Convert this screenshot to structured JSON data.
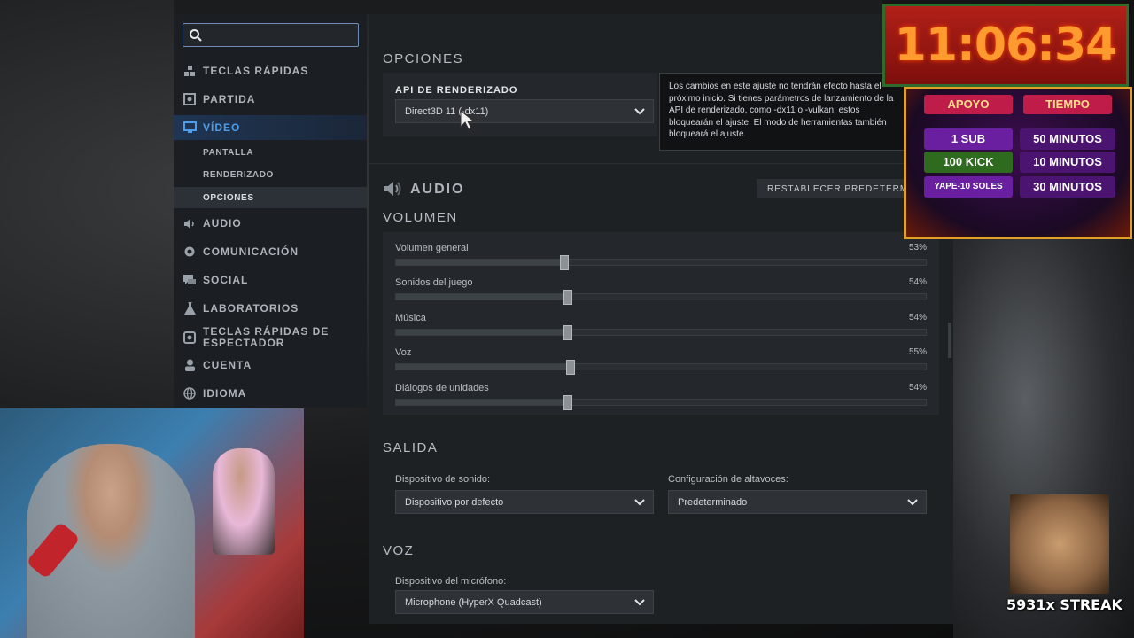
{
  "search": {
    "placeholder": ""
  },
  "sidebar": {
    "items": [
      {
        "label": "TECLAS RÁPIDAS",
        "icon": "hotkeys-icon"
      },
      {
        "label": "PARTIDA",
        "icon": "game-icon"
      },
      {
        "label": "VÍDEO",
        "icon": "monitor-icon",
        "active": true
      },
      {
        "label": "AUDIO",
        "icon": "speaker-icon"
      },
      {
        "label": "COMUNICACIÓN",
        "icon": "gear-icon"
      },
      {
        "label": "SOCIAL",
        "icon": "chat-icon"
      },
      {
        "label": "LABORATORIOS",
        "icon": "flask-icon"
      },
      {
        "label": "TECLAS RÁPIDAS DE ESPECTADOR",
        "icon": "spectator-icon"
      },
      {
        "label": "CUENTA",
        "icon": "user-icon"
      },
      {
        "label": "IDIOMA",
        "icon": "globe-icon"
      }
    ],
    "video_sub": [
      {
        "label": "PANTALLA"
      },
      {
        "label": "RENDERIZADO"
      },
      {
        "label": "OPCIONES",
        "selected": true
      }
    ]
  },
  "options": {
    "title": "OPCIONES",
    "api_label": "API DE RENDERIZADO",
    "api_value": "Direct3D 11 (-dx11)"
  },
  "tooltip": {
    "text": "Los cambios en este ajuste no tendrán efecto hasta el próximo inicio. Si tienes parámetros de lanzamiento de la API de renderizado, como -dx11 o -vulkan, estos bloquearán el ajuste. El modo de herramientas también bloqueará el ajuste."
  },
  "audio": {
    "title": "AUDIO",
    "reset_label": "RESTABLECER PREDETERMINADOS",
    "volume_title": "VOLUMEN",
    "sliders": [
      {
        "label": "Volumen general",
        "value": 53,
        "display": "53%"
      },
      {
        "label": "Sonidos del juego",
        "value": 54,
        "display": "54%"
      },
      {
        "label": "Música",
        "value": 54,
        "display": "54%"
      },
      {
        "label": "Voz",
        "value": 55,
        "display": "55%"
      },
      {
        "label": "Diálogos de unidades",
        "value": 54,
        "display": "54%"
      }
    ],
    "output_title": "SALIDA",
    "sound_device_label": "Dispositivo de sonido:",
    "sound_device_value": "Dispositivo por defecto",
    "speaker_config_label": "Configuración de altavoces:",
    "speaker_config_value": "Predeterminado",
    "voice_title": "VOZ",
    "mic_label": "Dispositivo del micrófono:",
    "mic_value": "Microphone (HyperX Quadcast)"
  },
  "overlay": {
    "clock": "11:06:34",
    "support_header": "APOYO",
    "time_header": "TIEMPO",
    "rows": [
      {
        "support": "1 SUB",
        "time": "50 MINUTOS"
      },
      {
        "support": "100 KICK",
        "time": "10 MINUTOS"
      },
      {
        "support": "YAPE-10 SOLES",
        "time": "30 MINUTOS"
      }
    ],
    "streak": "5931x STREAK"
  },
  "colors": {
    "accent": "#4f9ce8",
    "panel": "#1e2124",
    "sidebar": "#1b1e22"
  }
}
